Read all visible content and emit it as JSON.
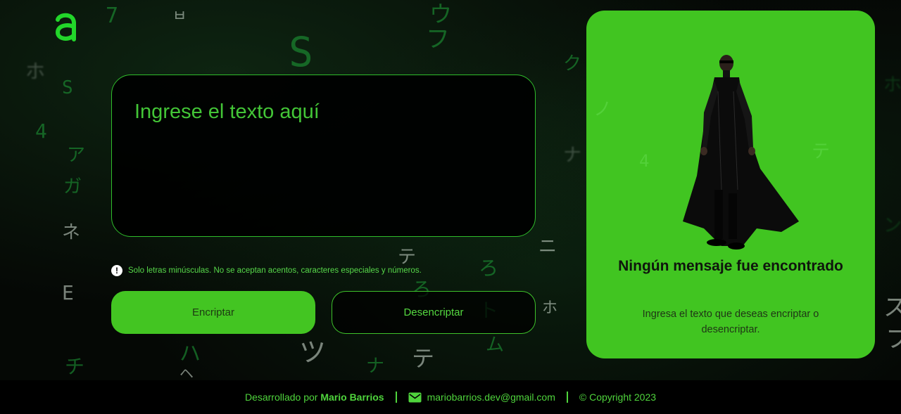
{
  "logo": {
    "icon": "alura-logo-icon",
    "color": "#22c52a"
  },
  "input": {
    "placeholder": "Ingrese el texto aquí",
    "value": ""
  },
  "info": {
    "icon": "exclamation-circle-icon",
    "text": "Solo letras minúsculas. No se aceptan acentos, caracteres especiales y números."
  },
  "buttons": {
    "encrypt_label": "Encriptar",
    "decrypt_label": "Desencriptar"
  },
  "output": {
    "title": "Ningún mensaje fue encontrado",
    "message": "Ingresa el texto que deseas encriptar o desencriptar.",
    "image": "neo-figure-illustration"
  },
  "footer": {
    "developed_by": "Desarrollado por",
    "author": "Mario Barrios",
    "email": "mariobarrios.dev@gmail.com",
    "email_icon": "mail-icon",
    "copyright": "© Copyright 2023"
  },
  "colors": {
    "accent": "#43c522",
    "text_green": "#4fd43c",
    "background": "#000000"
  }
}
